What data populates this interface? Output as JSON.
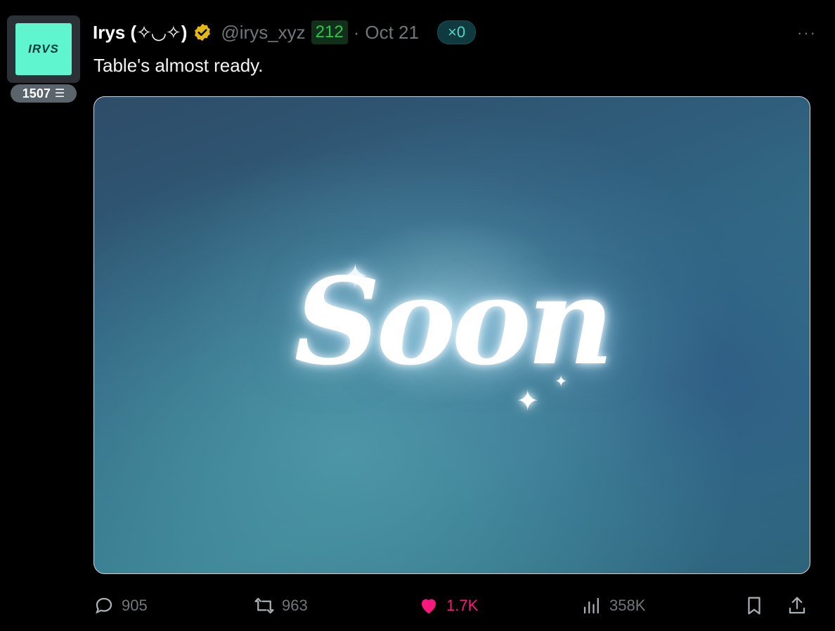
{
  "avatar": {
    "logo_text": "IRVS",
    "score": "1507"
  },
  "tweet": {
    "display_name": "Irys (✧◡✧)",
    "handle": "@irys_xyz",
    "badge_number": "212",
    "dot": "·",
    "time": "Oct 21",
    "multiplier": "×0",
    "text": "Table's almost ready.",
    "media_text": "Soon",
    "more": "···"
  },
  "actions": {
    "replies": "905",
    "reposts": "963",
    "likes": "1.7K",
    "views": "358K"
  },
  "colors": {
    "like": "#f91880",
    "muted": "#71767b",
    "verified": "#e2b719"
  }
}
